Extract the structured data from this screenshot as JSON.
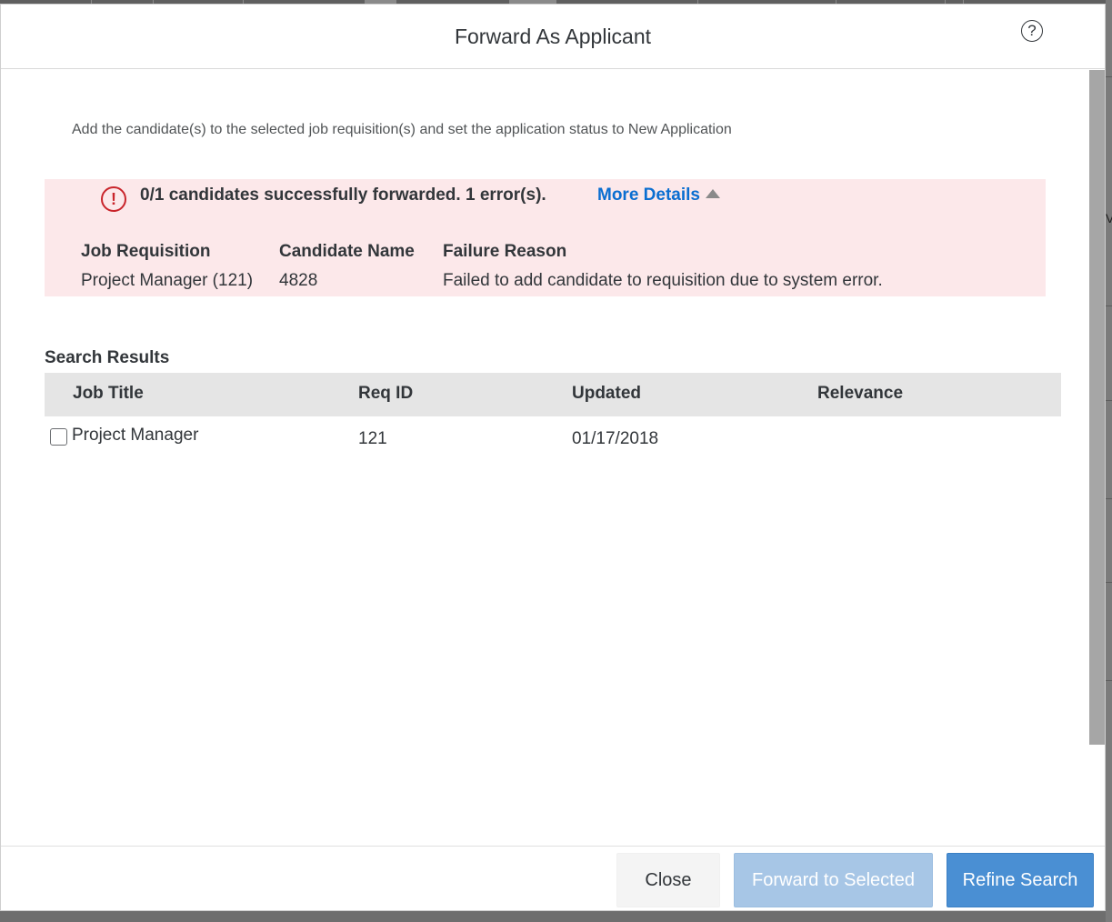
{
  "dialog": {
    "title": "Forward As Applicant",
    "help_icon": "?"
  },
  "description": "Add the candidate(s) to the selected job requisition(s) and set the application status to New Application",
  "error": {
    "icon": "!",
    "summary": "0/1 candidates successfully forwarded. 1 error(s).",
    "more_details_label": "More Details",
    "columns": [
      "Job Requisition",
      "Candidate Name",
      "Failure Reason"
    ],
    "rows": [
      {
        "job_requisition": "Project Manager (121)",
        "candidate_name": "4828",
        "failure_reason": "Failed to add candidate to requisition due to system error."
      }
    ],
    "colors": {
      "background": "#fce8ea",
      "icon": "#c9242b",
      "link": "#0a6ed1"
    }
  },
  "search_results": {
    "label": "Search Results",
    "columns": [
      "Job Title",
      "Req ID",
      "Updated",
      "Relevance"
    ],
    "rows": [
      {
        "checked": false,
        "job_title": "Project Manager",
        "req_id": "121",
        "updated": "01/17/2018",
        "relevance": ""
      }
    ]
  },
  "footer": {
    "close_label": "Close",
    "forward_label": "Forward to Selected",
    "refine_label": "Refine Search",
    "colors": {
      "primary": "#4a8fd3",
      "disabled_primary": "#a7c6e6"
    }
  },
  "backdrop": {
    "edge_glyph": "V"
  }
}
